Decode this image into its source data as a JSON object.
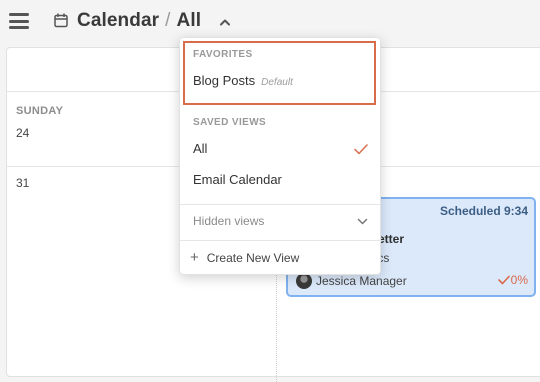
{
  "header": {
    "breadcrumb_root": "Calendar",
    "separator": "/",
    "breadcrumb_current": "All"
  },
  "calendar": {
    "day_header": "SUNDAY",
    "day_24": "24",
    "day_31": "31"
  },
  "event_card": {
    "status": "Scheduled 9:34",
    "title_partial": "sletter",
    "subtitle_partial": "pics",
    "owner": "Jessica Manager",
    "progress": "0%"
  },
  "dropdown": {
    "favorites_title": "FAVORITES",
    "favorites_item": "Blog Posts",
    "favorites_item_tag": "Default",
    "saved_title": "SAVED VIEWS",
    "saved_items": [
      "All",
      "Email Calendar"
    ],
    "selected_item": "All",
    "hidden_views": "Hidden views",
    "create_new": "Create New View"
  },
  "colors": {
    "accent_highlight": "#d86d4c",
    "card_bg": "#dbe9fb",
    "card_border": "#7fb2ee"
  }
}
